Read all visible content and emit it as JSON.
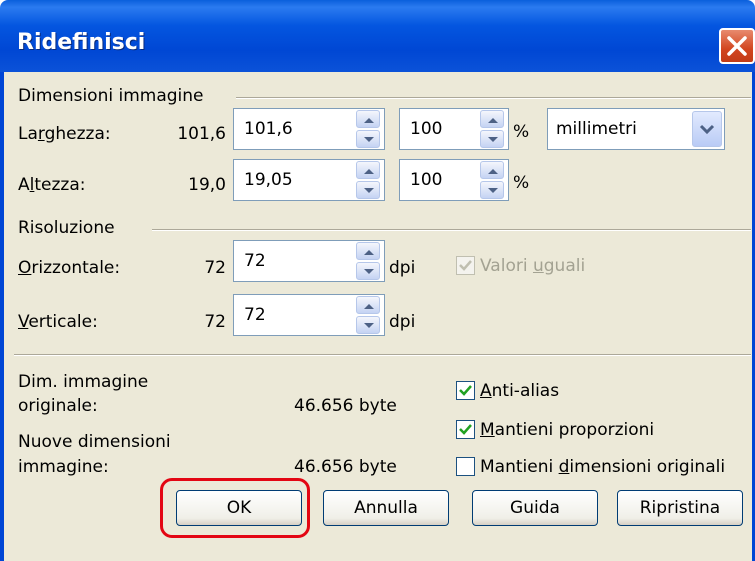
{
  "window": {
    "title": "Ridefinisci"
  },
  "image_size": {
    "section_label": "Dimensioni immagine",
    "width": {
      "label_pre": "La",
      "label_ul": "r",
      "label_post": "ghezza:",
      "original": "101,6",
      "value": "101,6",
      "percent": "100",
      "percent_sign": "%"
    },
    "height": {
      "label_pre": "A",
      "label_ul": "l",
      "label_post": "tezza:",
      "original": "19,0",
      "value": "19,05",
      "percent": "100",
      "percent_sign": "%"
    },
    "unit": {
      "selected": "millimetri"
    }
  },
  "resolution": {
    "section_label": "Risoluzione",
    "horizontal": {
      "label_ul": "O",
      "label_post": "rizzontale:",
      "original": "72",
      "value": "72",
      "unit": "dpi"
    },
    "vertical": {
      "label_ul": "V",
      "label_post": "erticale:",
      "original": "72",
      "value": "72",
      "unit": "dpi"
    },
    "equal_values": {
      "label_pre": "Valori ",
      "label_ul": "u",
      "label_post": "guali",
      "checked": true,
      "enabled": false
    }
  },
  "info": {
    "original_label_1": "Dim. immagine",
    "original_label_2": "originale:",
    "original_value": "46.656 byte",
    "new_label_1": "Nuove dimensioni",
    "new_label_2": "immagine:",
    "new_value": "46.656 byte"
  },
  "options": {
    "antialias": {
      "label_ul": "A",
      "label_post": "nti-alias",
      "checked": true
    },
    "keep_ratio": {
      "label_ul": "M",
      "label_post": "antieni proporzioni",
      "checked": true
    },
    "keep_original": {
      "label_pre": "Mantieni ",
      "label_ul": "d",
      "label_post": "imensioni originali",
      "checked": false
    }
  },
  "buttons": {
    "ok": "OK",
    "cancel": "Annulla",
    "help": "Guida",
    "reset": "Ripristina"
  },
  "colors": {
    "title_bar": "#0047d4",
    "dialog_bg": "#ece9d8",
    "highlight": "#e30613",
    "check": "#21a121"
  }
}
